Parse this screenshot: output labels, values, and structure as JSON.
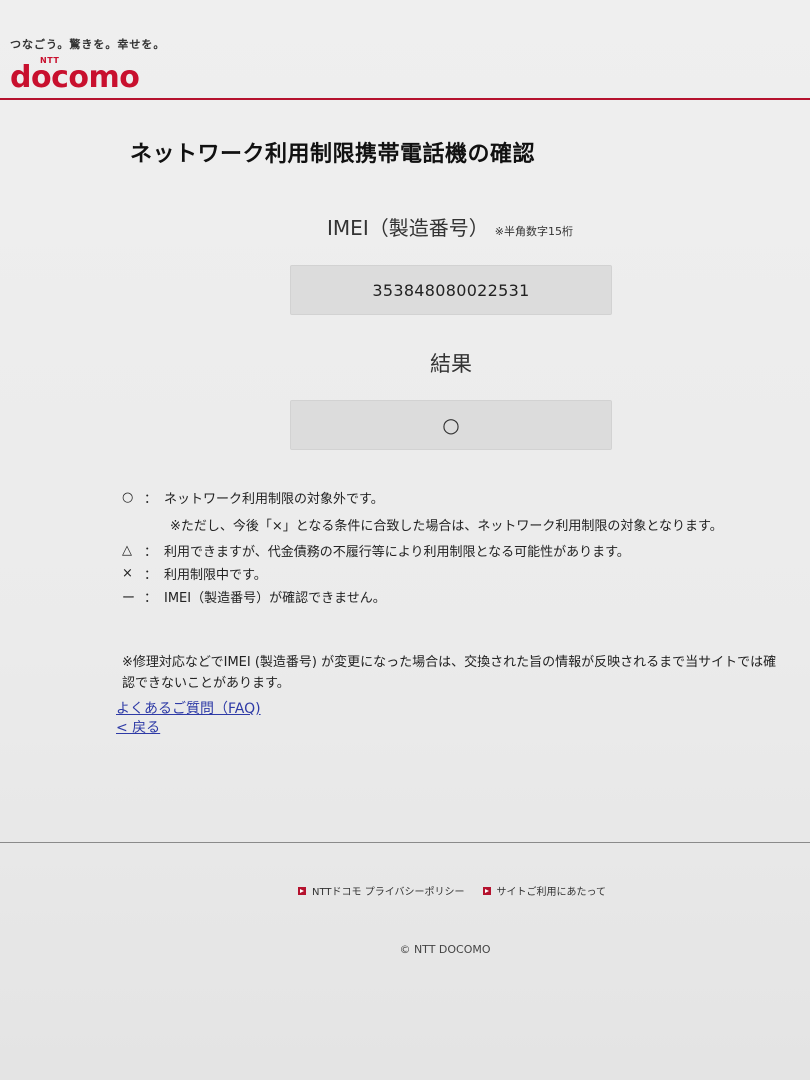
{
  "header": {
    "tagline": "つなごう。驚きを。幸せを。",
    "logo_small": "NTT",
    "logo": "docomo"
  },
  "title": "ネットワーク利用制限携帯電話機の確認",
  "imei": {
    "label": "IMEI（製造番号）",
    "note": "※半角数字15桁",
    "value": "353848080022531"
  },
  "result": {
    "label": "結果",
    "value": "○"
  },
  "legend": [
    {
      "symbol": "○",
      "colon": "：",
      "text": "ネットワーク利用制限の対象外です。",
      "sub": "※ただし、今後「×」となる条件に合致した場合は、ネットワーク利用制限の対象となります。"
    },
    {
      "symbol": "△",
      "colon": "：",
      "text": "利用できますが、代金債務の不履行等により利用制限となる可能性があります。"
    },
    {
      "symbol": "×",
      "colon": "：",
      "text": "利用制限中です。"
    },
    {
      "symbol": "ー",
      "colon": "：",
      "text": "IMEI（製造番号）が確認できません。"
    }
  ],
  "footnote": "※修理対応などでIMEI (製造番号) が変更になった場合は、交換された旨の情報が反映されるまで当サイトでは確認できないことがあります。",
  "links": {
    "faq": "よくあるご質問（FAQ)",
    "back": "< 戻る"
  },
  "footer": {
    "privacy": "NTTドコモ プライバシーポリシー",
    "terms": "サイトご利用にあたって",
    "copyright": "© NTT DOCOMO"
  },
  "colors": {
    "brand": "#c8102e",
    "link": "#2e3aa6"
  }
}
